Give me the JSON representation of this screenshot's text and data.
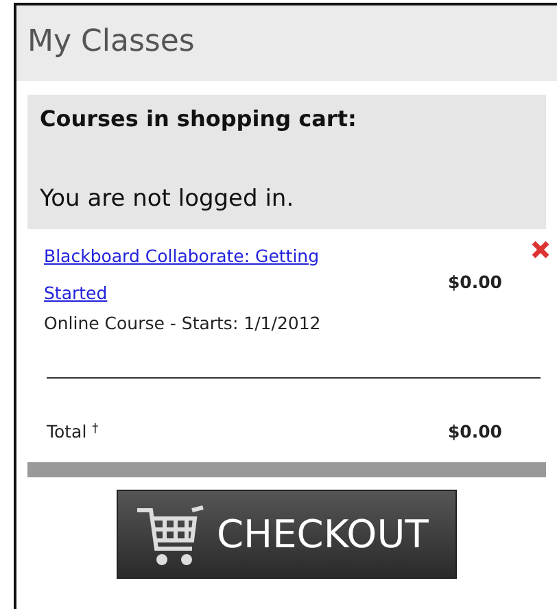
{
  "panel": {
    "title": "My Classes"
  },
  "cart": {
    "heading": "Courses in shopping cart:",
    "login_notice": "You are not logged in.",
    "items": [
      {
        "title": "Blackboard Collaborate: Getting Started",
        "price": "$0.00",
        "details": "Online Course - Starts: 1/1/2012"
      }
    ],
    "total_label": "Total $^{†}$",
    "total": "$0.00"
  },
  "checkout_button": "CHECKOUT"
}
